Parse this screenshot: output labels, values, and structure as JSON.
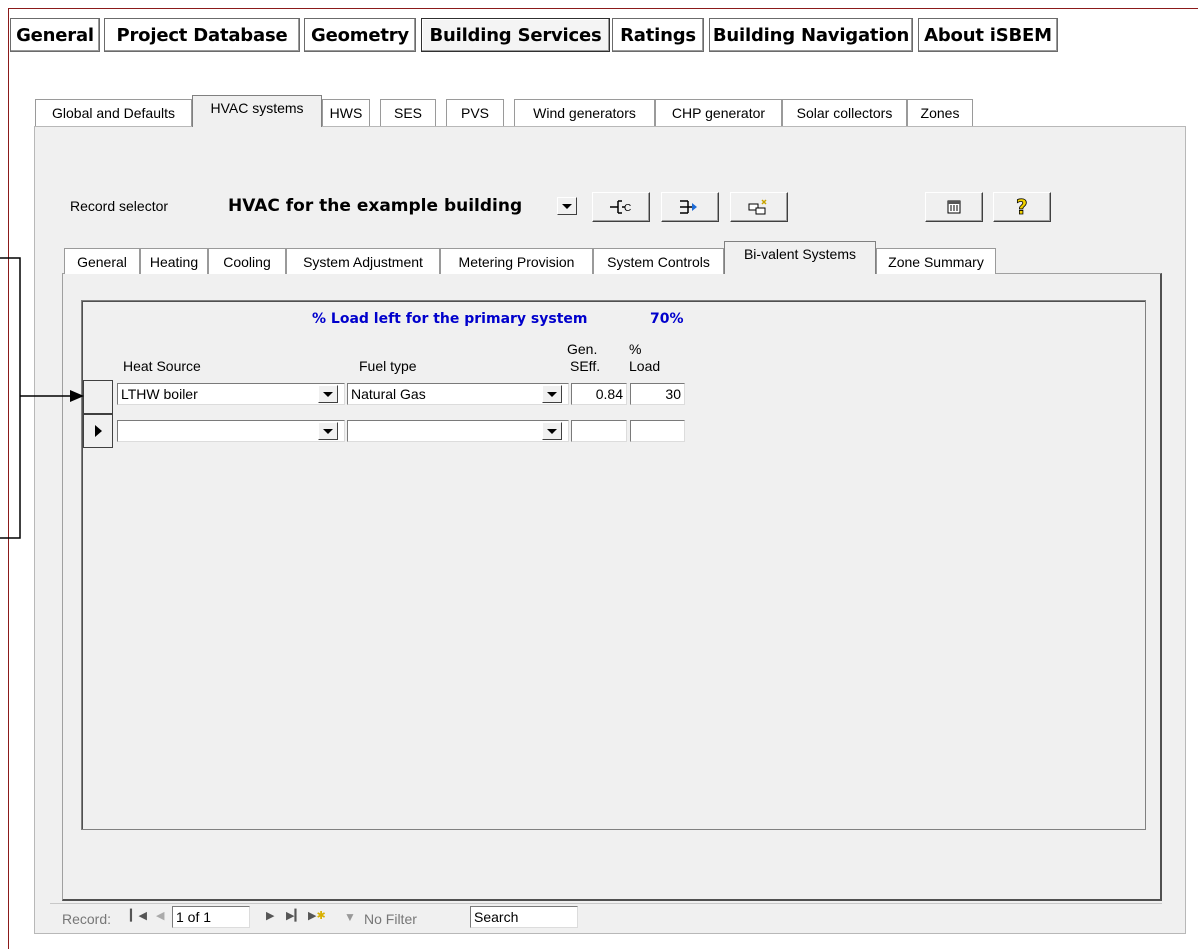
{
  "top_tabs": [
    "General",
    "Project Database",
    "Geometry",
    "Building Services",
    "Ratings",
    "Building Navigation",
    "About iSBEM"
  ],
  "top_tabs_active": "Building Services",
  "second_tabs": [
    "Global and Defaults",
    "HVAC systems",
    "HWS",
    "SES",
    "PVS",
    "Wind generators",
    "CHP generator",
    "Solar collectors",
    "Zones"
  ],
  "second_tabs_active": "HVAC systems",
  "record_selector": {
    "label": "Record selector",
    "value": "HVAC for the example building"
  },
  "toolbar_icons": [
    "add-record-icon",
    "copy-record-icon",
    "delete-record-icon",
    "calculator-icon",
    "help-icon"
  ],
  "third_tabs": [
    "General",
    "Heating",
    "Cooling",
    "System Adjustment",
    "Metering Provision",
    "System Controls",
    "Bi-valent Systems",
    "Zone Summary"
  ],
  "third_tabs_active": "Bi-valent Systems",
  "subform": {
    "summary_label": "% Load left for the primary system",
    "summary_value": "70%",
    "columns": {
      "heat_source": "Heat Source",
      "fuel_type": "Fuel type",
      "gen_seff_1": "Gen.",
      "gen_seff_2": "SEff.",
      "load_1": "%",
      "load_2": "Load"
    },
    "rows": [
      {
        "heat_source": "LTHW boiler",
        "fuel_type": "Natural Gas",
        "gen_seff": "0.84",
        "load": "30"
      },
      {
        "heat_source": "",
        "fuel_type": "",
        "gen_seff": "",
        "load": ""
      }
    ]
  },
  "navigation": {
    "record_label": "Record:",
    "position": "1 of 1",
    "filter": "No Filter",
    "search": "Search"
  },
  "colors": {
    "summary_text": "#0000cc",
    "frame_line": "#8b1a1a"
  }
}
